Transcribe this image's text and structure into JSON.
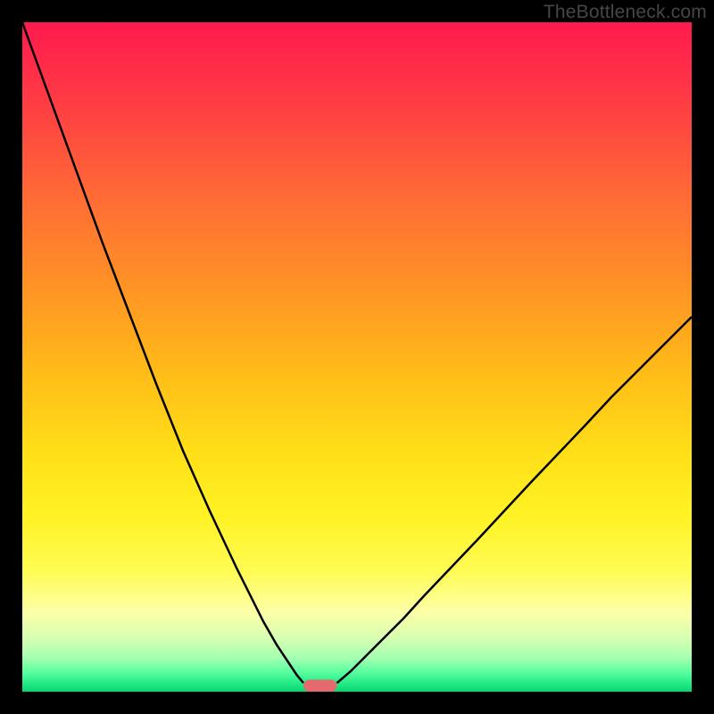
{
  "watermark": "TheBottleneck.com",
  "chart_data": {
    "type": "line",
    "title": "",
    "xlabel": "",
    "ylabel": "",
    "xlim": [
      0,
      100
    ],
    "ylim": [
      0,
      100
    ],
    "gradient_bands": [
      {
        "y": 100,
        "color": "#ff1a4e"
      },
      {
        "y": 88,
        "color": "#ff3c44"
      },
      {
        "y": 74,
        "color": "#ff6b35"
      },
      {
        "y": 60,
        "color": "#ff9424"
      },
      {
        "y": 48,
        "color": "#ffbb18"
      },
      {
        "y": 36,
        "color": "#ffde18"
      },
      {
        "y": 26,
        "color": "#fff325"
      },
      {
        "y": 18,
        "color": "#fffc54"
      },
      {
        "y": 12,
        "color": "#fdffa6"
      },
      {
        "y": 8,
        "color": "#d7ffb2"
      },
      {
        "y": 5,
        "color": "#a3ffb1"
      },
      {
        "y": 3,
        "color": "#5cffa0"
      },
      {
        "y": 1.5,
        "color": "#2bee89"
      },
      {
        "y": 0,
        "color": "#06d670"
      }
    ],
    "series": [
      {
        "name": "left-branch",
        "x": [
          0,
          4,
          8,
          12,
          16,
          20,
          24,
          28,
          32,
          36,
          38,
          40,
          41,
          42
        ],
        "values": [
          100,
          89,
          78,
          67,
          56.5,
          46,
          36,
          27,
          18.5,
          10.5,
          7,
          4,
          2.5,
          1.3
        ]
      },
      {
        "name": "right-branch",
        "x": [
          47,
          49,
          51,
          54,
          57,
          60,
          64,
          68,
          72,
          76,
          80,
          84,
          88,
          92,
          96,
          100
        ],
        "values": [
          1.3,
          3,
          5,
          8,
          11,
          14.3,
          18.5,
          22.7,
          27,
          31.3,
          35.5,
          39.7,
          44,
          48,
          52,
          56
        ]
      }
    ],
    "marker": {
      "name": "bottom-marker",
      "x_center": 44.5,
      "width": 5,
      "y": 0.9,
      "color": "#e46a6e"
    }
  }
}
